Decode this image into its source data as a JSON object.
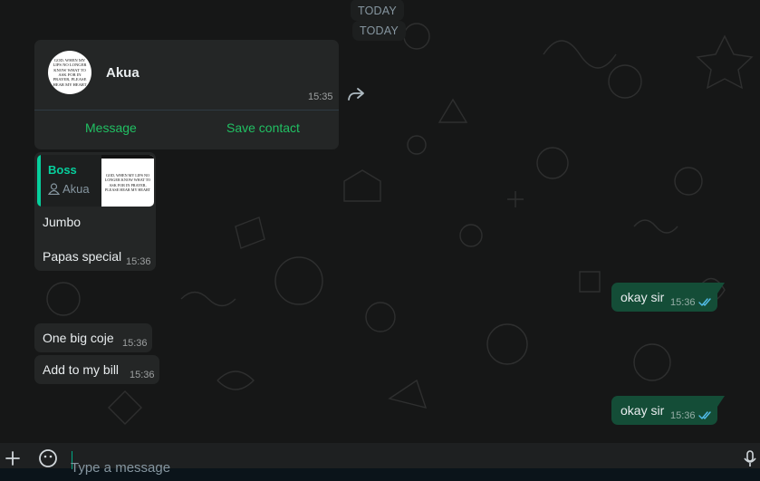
{
  "date_chips": [
    "TODAY",
    "TODAY"
  ],
  "contact_card": {
    "name": "Akua",
    "time": "15:35",
    "avatar_text": "GOD, WHEN MY LIPS NO LONGER KNOW WHAT TO ASK FOR IN PRAYER, PLEASE HEAR MY HEART",
    "actions": {
      "message": "Message",
      "save_contact": "Save contact"
    }
  },
  "reply_message": {
    "quoted_author": "Boss",
    "quoted_sub": "Akua",
    "quoted_thumb_text": "GOD, WHEN MY LIPS NO LONGER KNOW WHAT TO ASK FOR IN PRAYER, PLEASE HEAR MY HEART",
    "line1": "Jumbo",
    "line2": "Papas special",
    "time": "15:36"
  },
  "incoming": [
    {
      "text": "One big coje",
      "time": "15:36"
    },
    {
      "text": "Add to my bill",
      "time": "15:36"
    }
  ],
  "outgoing": [
    {
      "text": "okay sir",
      "time": "15:36",
      "status": "read"
    },
    {
      "text": "okay sir",
      "time": "15:36",
      "status": "read"
    }
  ],
  "composer": {
    "placeholder": "Type a message"
  },
  "colors": {
    "accent": "#21c063",
    "quote_accent": "#06cf9c",
    "outgoing_bubble": "#144d37",
    "incoming_bubble": "#242626",
    "read_ticks": "#53bdeb"
  },
  "icons": [
    "forward-icon",
    "contact-icon",
    "double-check-icon",
    "plus-icon",
    "emoji-icon",
    "mic-icon"
  ]
}
